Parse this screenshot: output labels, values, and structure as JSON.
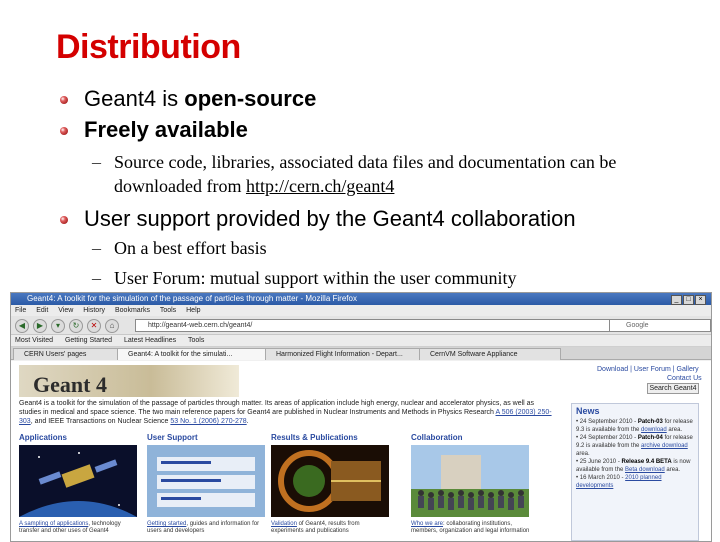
{
  "slide": {
    "title": "Distribution",
    "bullets": [
      {
        "pre": "Geant4 is ",
        "bold": "open-source"
      },
      {
        "pre": "",
        "bold": "Freely available"
      }
    ],
    "sub1": {
      "dash": "–",
      "text": "Source code, libraries, associated data files and documentation can be downloaded from ",
      "link": "http://cern.ch/geant4"
    },
    "bullet3": "User support provided by the Geant4 collaboration",
    "sub2": [
      {
        "dash": "–",
        "text": "On a best effort basis"
      },
      {
        "dash": "–",
        "text": "User Forum: mutual support within the user community"
      }
    ]
  },
  "browser": {
    "window_title": "Geant4: A toolkit for the simulation of the passage of particles through matter - Mozilla Firefox",
    "menu": [
      "File",
      "Edit",
      "View",
      "History",
      "Bookmarks",
      "Tools",
      "Help"
    ],
    "url": "http://geant4-web.cern.ch/geant4/",
    "search_placeholder": "Google",
    "bookmarks": [
      "Most Visited",
      "Getting Started",
      "Latest Headlines",
      "Tools",
      "CERN Users' pages"
    ],
    "tabs": [
      "Geant4: A toolkit for the simulati...",
      "Harmonized Flight Information - Depart...",
      "CernVM Software Appliance"
    ],
    "page": {
      "logo": "Geant 4",
      "top_links": "Download | User Forum | Gallery",
      "contact": "Contact Us",
      "search_button": "Search Geant4",
      "intro": "Geant4 is a toolkit for the simulation of the passage of particles through matter. Its areas of application include high energy, nuclear and accelerator physics, as well as studies in medical and space science. The two main reference papers for Geant4 are published in Nuclear Instruments and Methods in Physics Research ",
      "intro_ref1": "A 506 (2003) 250-303",
      "intro_mid": ", and IEEE Transactions on Nuclear Science ",
      "intro_ref2": "53 No. 1 (2006) 270-278",
      "intro_end": ".",
      "columns": [
        {
          "heading": "Applications",
          "caption_link": "A sampling of applications",
          "caption": ", technology transfer and other uses of Geant4"
        },
        {
          "heading": "User Support",
          "caption_link": "Getting started",
          "caption": ", guides and information for users and developers"
        },
        {
          "heading": "Results & Publications",
          "caption_link": "Validation",
          "caption": " of Geant4, results from experiments and publications"
        },
        {
          "heading": "Collaboration",
          "caption_link": "Who we are",
          "caption": ": collaborating institutions, members, organization and legal information"
        }
      ],
      "news": {
        "heading": "News",
        "items": [
          {
            "date": "24 September 2010 -",
            "bold": "Patch-03",
            "text": " for release 9.3 is available from the ",
            "link": "download",
            "end": " area."
          },
          {
            "date": "24 September 2010 -",
            "bold": "Patch-04",
            "text": " for release 9.2 is available from the ",
            "link": "archive download",
            "end": " area."
          },
          {
            "date": "25 June 2010 -",
            "bold": "Release 9.4 BETA",
            "text": " is now available from the ",
            "link": "Beta download",
            "end": " area."
          },
          {
            "date": "16 March 2010 -",
            "bold": "",
            "text": "",
            "link": "2010 planned developments",
            "end": ""
          }
        ]
      }
    }
  },
  "colors": {
    "title": "#d40000",
    "link": "#2a4aa0",
    "news_bg": "#f1f4fa"
  }
}
